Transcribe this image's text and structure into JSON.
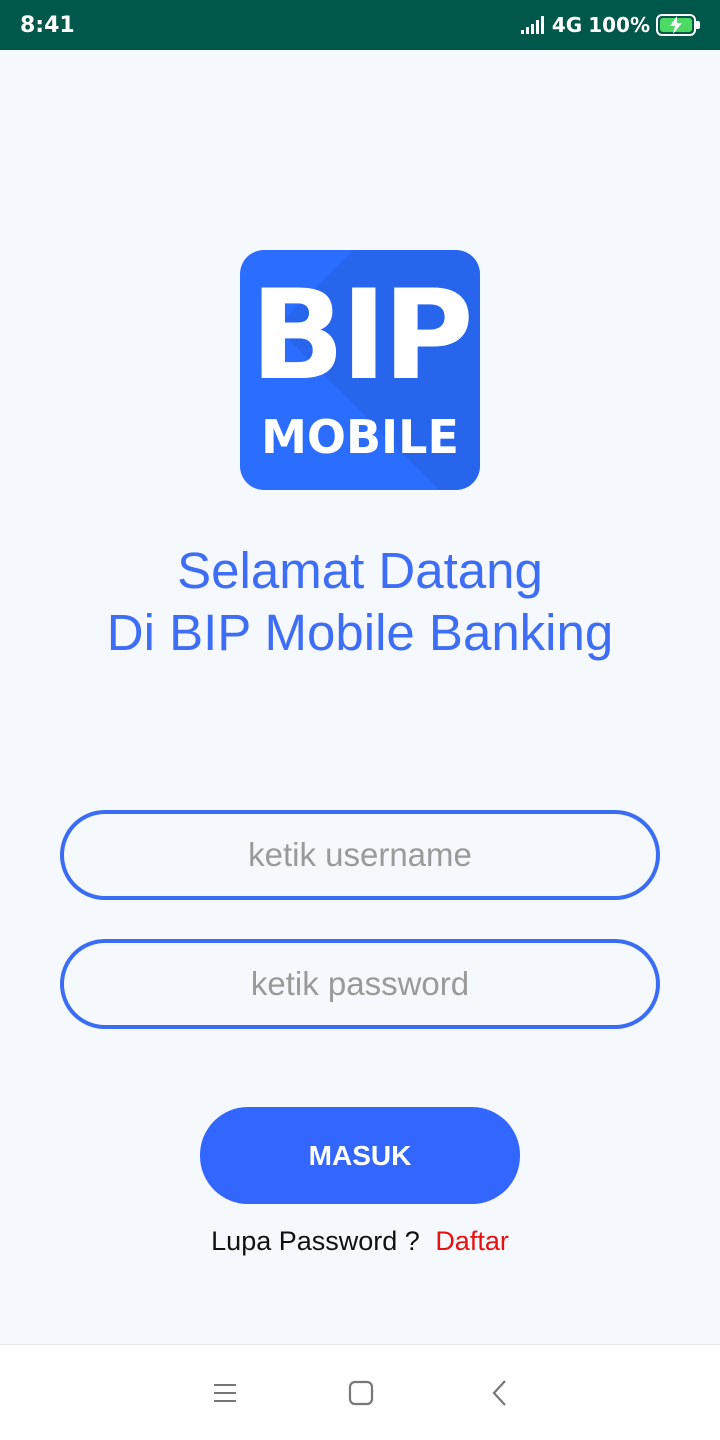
{
  "status_bar": {
    "time": "8:41",
    "network": "4G",
    "battery": "100%"
  },
  "logo": {
    "line1": "BIP",
    "line2": "MOBILE"
  },
  "welcome": {
    "line1": "Selamat Datang",
    "line2": "Di BIP Mobile Banking"
  },
  "form": {
    "username_placeholder": "ketik username",
    "password_placeholder": "ketik password",
    "login_label": "MASUK"
  },
  "links": {
    "forgot_password": "Lupa Password ?",
    "register": "Daftar"
  },
  "nav_bar": {
    "icons": [
      "menu-icon",
      "home-icon",
      "back-icon"
    ]
  },
  "colors": {
    "status_bar": "#00584a",
    "brand_blue": "#2a6dff",
    "heading_blue": "#3d6ef5",
    "button_blue": "#3366ff",
    "register_red": "#e81010",
    "background": "#f5f8fc"
  }
}
